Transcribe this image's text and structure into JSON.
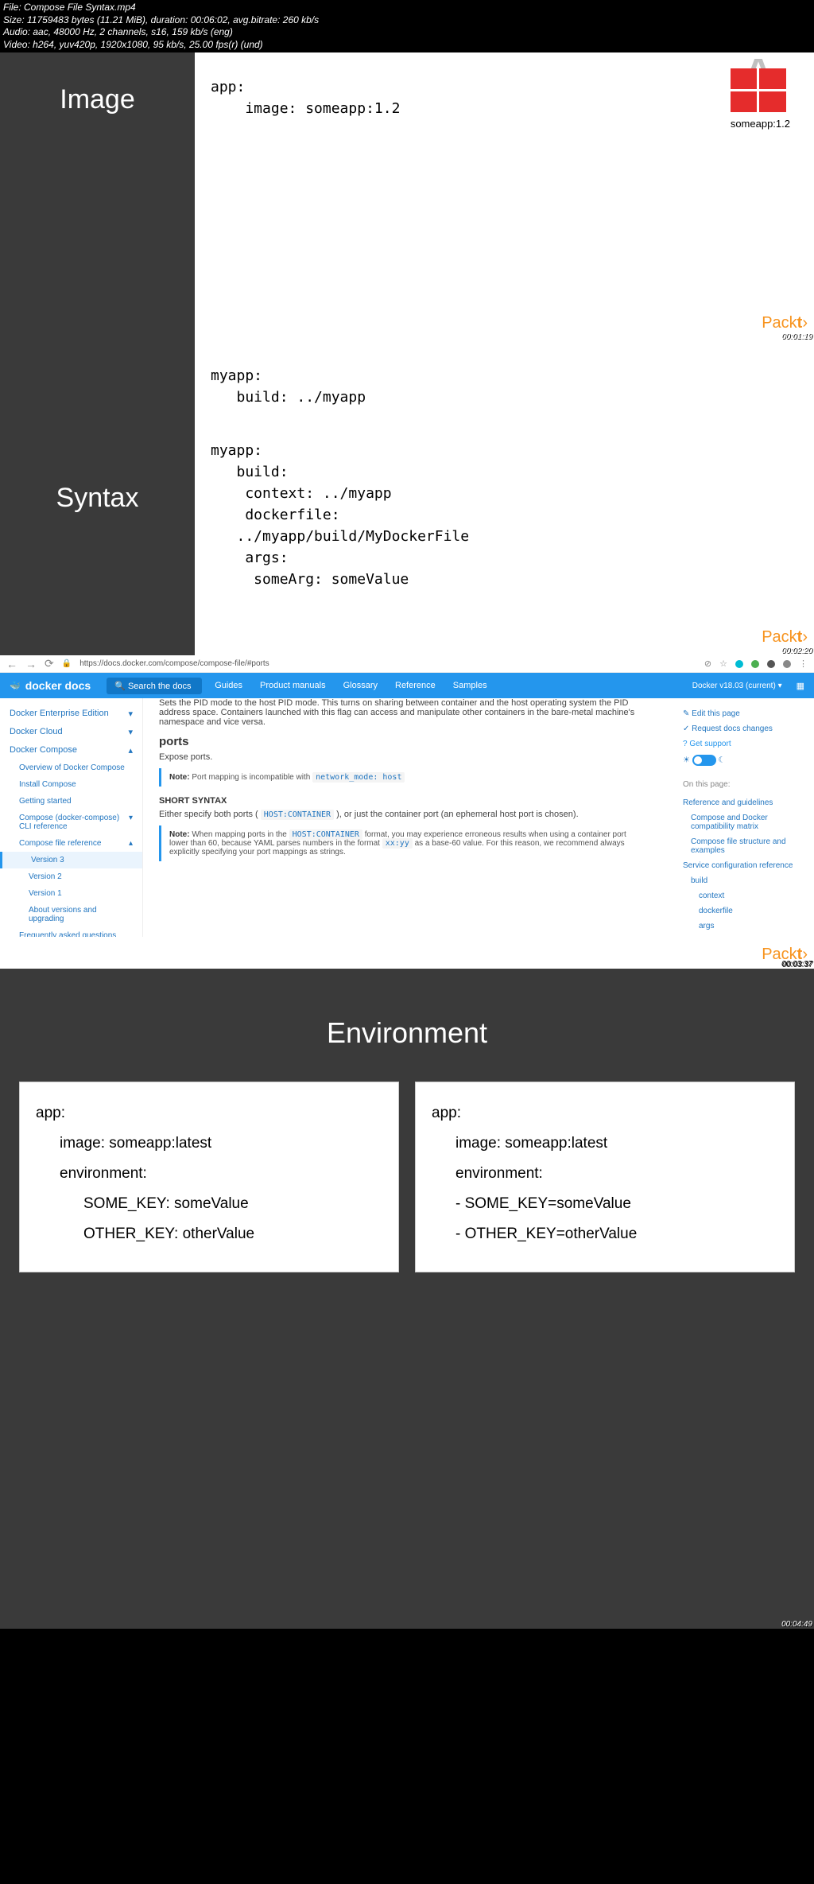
{
  "meta": {
    "file": "File: Compose File Syntax.mp4",
    "size": "Size: 11759483 bytes (11.21 MiB), duration: 00:06:02, avg.bitrate: 260 kb/s",
    "audio": "Audio: aac, 48000 Hz, 2 channels, s16, 159 kb/s (eng)",
    "video": "Video: h264, yuv420p, 1920x1080, 95 kb/s, 25.00 fps(r) (und)"
  },
  "panel1": {
    "title": "Image",
    "code": "app:\n    image: someapp:1.2",
    "label": "someapp:1.2",
    "timestamp": "00:01:19"
  },
  "panel2": {
    "title": "Syntax",
    "code1": "myapp:\n   build: ../myapp",
    "code2": "myapp:\n   build:\n    context: ../myapp\n    dockerfile:\n   ../myapp/build/MyDockerFile\n    args:\n     someArg: someValue",
    "timestamp": "00:02:20"
  },
  "browser": {
    "url": "https://docs.docker.com/compose/compose-file/#ports",
    "logo": "docker docs",
    "search": "Search the docs",
    "nav": [
      "Guides",
      "Product manuals",
      "Glossary",
      "Reference",
      "Samples"
    ],
    "version": "Docker v18.03 (current) ▾",
    "sidebar": {
      "i1": "Docker Enterprise Edition",
      "i2": "Docker Cloud",
      "i3": "Docker Compose",
      "s1": "Overview of Docker Compose",
      "s2": "Install Compose",
      "s3": "Getting started",
      "s4": "Compose (docker-compose) CLI reference",
      "s5": "Compose file reference",
      "v3": "Version 3",
      "v2": "Version 2",
      "v1": "Version 1",
      "about": "About versions and upgrading",
      "faq": "Frequently asked questions"
    },
    "doc": {
      "intro": "Sets the PID mode to the host PID mode. This turns on sharing between container and the host operating system the PID address space. Containers launched with this flag can access and manipulate other containers in the bare-metal machine's namespace and vice versa.",
      "h_ports": "ports",
      "expose": "Expose ports.",
      "note1_pre": "Note:",
      "note1": " Port mapping is incompatible with ",
      "note1_code": "network_mode: host",
      "short": "SHORT SYNTAX",
      "spec_pre": "Either specify both ports ( ",
      "spec_code": "HOST:CONTAINER",
      "spec_post": " ), or just the container port (an ephemeral host port is chosen).",
      "note2_pre": "Note:",
      "note2a": " When mapping ports in the ",
      "note2_code1": "HOST:CONTAINER",
      "note2b": " format, you may experience erroneous results when using a container port lower than 60, because YAML parses numbers in the format ",
      "note2_code2": "xx:yy",
      "note2c": " as a base-60 value. For this reason, we recommend always explicitly specifying your port mappings as strings."
    },
    "right": {
      "edit": "Edit this page",
      "req": "Request docs changes",
      "sup": "Get support",
      "onpage": "On this page:",
      "r1": "Reference and guidelines",
      "r2": "Compose and Docker compatibility matrix",
      "r3": "Compose file structure and examples",
      "r4": "Service configuration reference",
      "r5": "build",
      "r6": "context",
      "r7": "dockerfile",
      "r8": "args"
    },
    "timestamp": "00:03:37"
  },
  "env": {
    "title": "Environment",
    "card1": {
      "l1": "app:",
      "l2": "image: someapp:latest",
      "l3": "environment:",
      "l4": "SOME_KEY: someValue",
      "l5": "OTHER_KEY: otherValue"
    },
    "card2": {
      "l1": "app:",
      "l2": "image: someapp:latest",
      "l3": "environment:",
      "l4": "-  SOME_KEY=someValue",
      "l5": "-  OTHER_KEY=otherValue"
    },
    "timestamp": "00:04:49"
  },
  "brand": {
    "p1": "Pack",
    "p2": "t",
    "p3": "›"
  }
}
